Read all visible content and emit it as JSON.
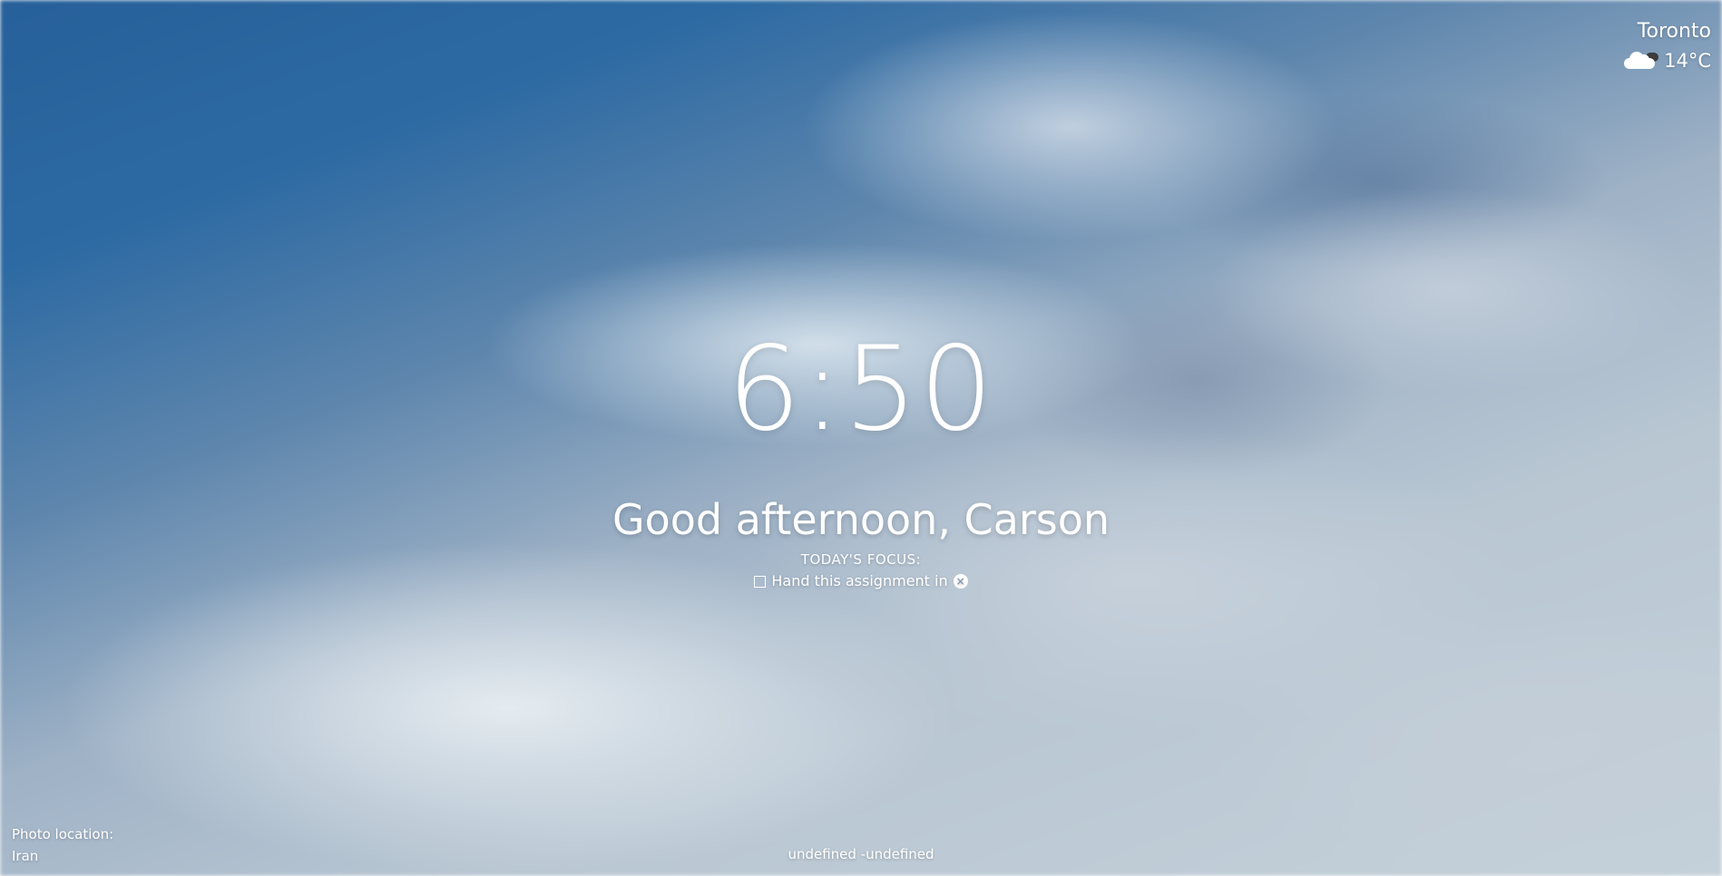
{
  "weather": {
    "city": "Toronto",
    "icon": "partly-cloudy-icon",
    "temperature": "14°C"
  },
  "clock": {
    "time": "6:50"
  },
  "greeting": {
    "text": "Good afternoon, Carson"
  },
  "focus": {
    "label": "TODAY'S FOCUS:",
    "task": "Hand this assignment in",
    "checked": false,
    "remove_icon": "close-circle-icon"
  },
  "photo": {
    "label": "Photo location:",
    "location": "Iran"
  },
  "quote": {
    "text": "undefined -undefined"
  },
  "colors": {
    "text": "#ffffff",
    "sky_blue": "#2d6aa3",
    "cloud_grey": "#c5d1da"
  }
}
